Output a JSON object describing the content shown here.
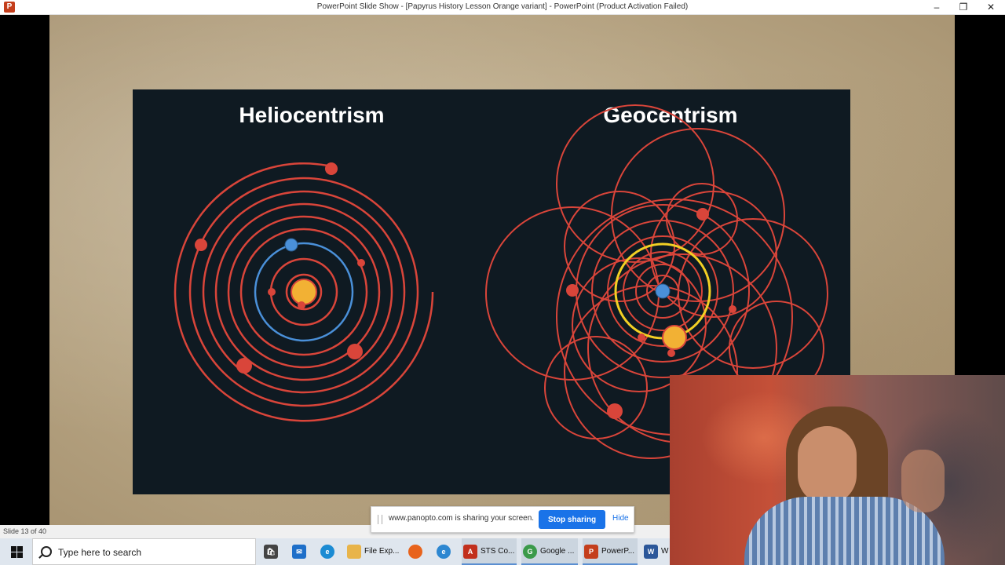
{
  "window": {
    "title": "PowerPoint Slide Show - [Papyrus History Lesson Orange variant] - PowerPoint (Product Activation Failed)",
    "app_icon": "powerpoint-icon",
    "minimize": "–",
    "restore": "❐",
    "close": "✕"
  },
  "slide": {
    "heading_left": "Heliocentrism",
    "heading_right": "Geocentrism",
    "counter": "Slide 13 of 40"
  },
  "colors": {
    "orbit": "#d9453a",
    "earth": "#4a90d9",
    "sun": "#f2b134",
    "planet": "#d9453a",
    "diagram_bg": "#0f1a22"
  },
  "share_bar": {
    "message": "www.panopto.com is sharing your screen.",
    "stop_label": "Stop sharing",
    "hide_label": "Hide"
  },
  "taskbar": {
    "search_placeholder": "Type here to search",
    "apps": [
      {
        "label": "",
        "icon": "store-icon",
        "color": "#444"
      },
      {
        "label": "",
        "icon": "mail-icon",
        "color": "#1e6fc9"
      },
      {
        "label": "",
        "icon": "edge-icon",
        "color": "#1b8bd3"
      },
      {
        "label": "File Exp...",
        "icon": "folder-icon",
        "color": "#e8b44a"
      },
      {
        "label": "",
        "icon": "firefox-icon",
        "color": "#e8631c"
      },
      {
        "label": "",
        "icon": "ie-icon",
        "color": "#2d87d1"
      },
      {
        "label": "STS Co...",
        "icon": "pdf-icon",
        "color": "#c2301d"
      },
      {
        "label": "Google ...",
        "icon": "chrome-icon",
        "color": "#3b9a4a"
      },
      {
        "label": "PowerP...",
        "icon": "powerpoint-icon",
        "color": "#c43e1c"
      },
      {
        "label": "W",
        "icon": "word-icon",
        "color": "#2b579a"
      }
    ]
  }
}
